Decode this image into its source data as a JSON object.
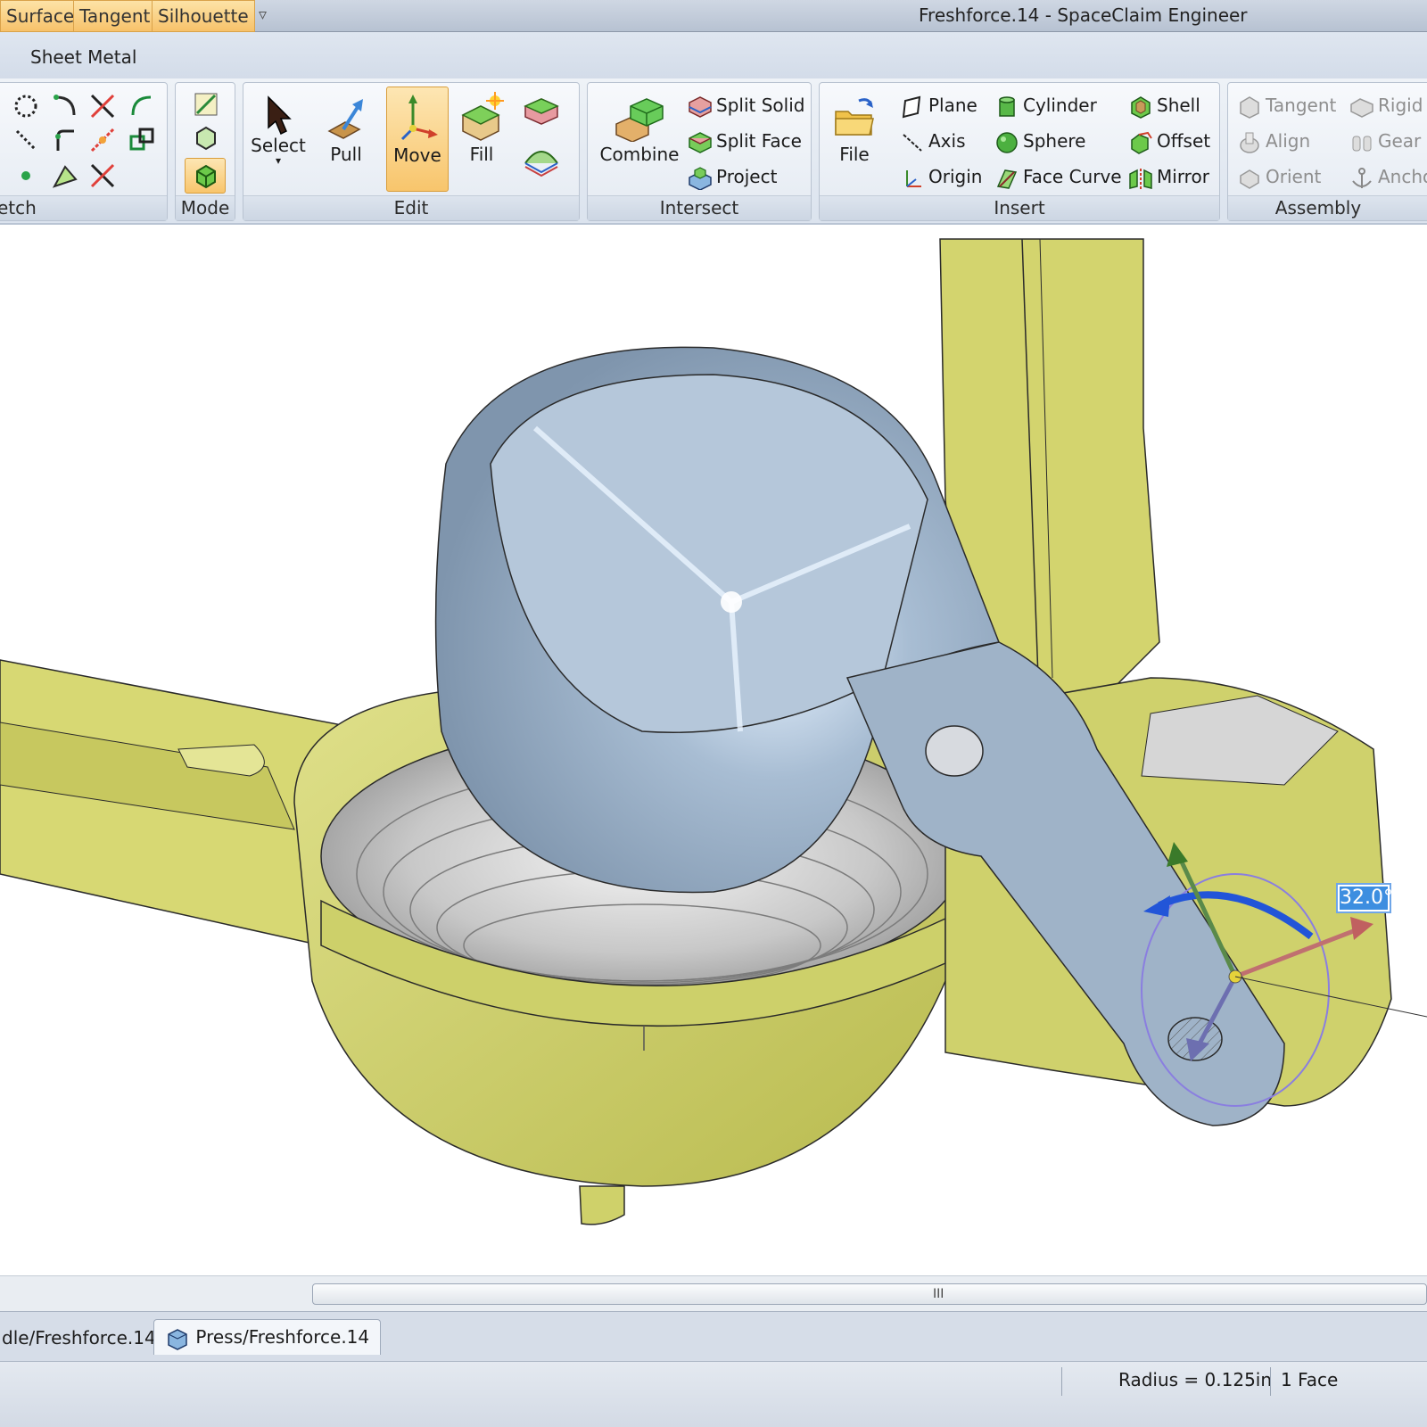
{
  "window": {
    "title": "Freshforce.14 - SpaceClaim Engineer",
    "quick_toggles": [
      "Surface",
      "Tangent",
      "Silhouette"
    ],
    "quick_more": "▿"
  },
  "ribbon_tab": "Sheet Metal",
  "groups": {
    "sketch": "etch",
    "mode": "Mode",
    "edit": "Edit",
    "intersect": "Intersect",
    "insert": "Insert",
    "assembly": "Assembly"
  },
  "edit_buttons": {
    "select": "Select",
    "pull": "Pull",
    "move": "Move",
    "fill": "Fill"
  },
  "intersect_buttons": {
    "combine": "Combine",
    "split_solid": "Split Solid",
    "split_face": "Split Face",
    "project": "Project"
  },
  "insert_buttons": {
    "file": "File",
    "plane": "Plane",
    "axis": "Axis",
    "origin": "Origin",
    "cylinder": "Cylinder",
    "sphere": "Sphere",
    "face_curve": "Face Curve",
    "shell": "Shell",
    "offset": "Offset",
    "mirror": "Mirror"
  },
  "assembly_buttons": {
    "tangent": "Tangent",
    "align": "Align",
    "orient": "Orient",
    "rigid": "Rigid",
    "gear": "Gear",
    "anchor": "Ancho"
  },
  "viewport": {
    "angle_value": "32.0°"
  },
  "scrollbar": {
    "grip": "III"
  },
  "doc_tabs": [
    "dle/Freshforce.14",
    "Press/Freshforce.14"
  ],
  "status": {
    "radius": "Radius = 0.125in",
    "selection": "1 Face"
  },
  "colors": {
    "part_yellow": "#cfd168",
    "part_blue": "#9fb3c8",
    "accent_orange": "#f8c56c",
    "accent_blue": "#3d8ee0"
  }
}
